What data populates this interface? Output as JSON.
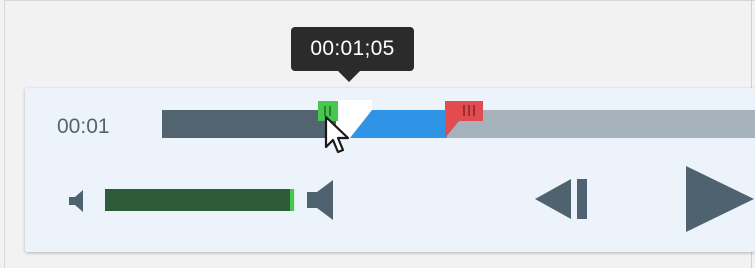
{
  "tooltip": {
    "time": "00:01;05"
  },
  "player": {
    "current_time": "00:01",
    "timeline": {
      "played_fraction": 0.305,
      "selection_end_fraction": 0.48
    },
    "volume": {
      "level": 0.99
    }
  },
  "colors": {
    "played": "#516470",
    "selection": "#2f94e6",
    "remaining": "#a7b3bc",
    "in_marker": "#45c84e",
    "out_marker": "#e04c4f",
    "volume_fill": "#2e5b3a",
    "icon": "#4f6270"
  },
  "icons": {
    "in_marker": "in-point-marker-icon",
    "out_marker": "out-point-marker-icon",
    "playhead": "playhead-icon",
    "cursor": "mouse-pointer-icon",
    "volume_low": "volume-low-icon",
    "volume_high": "volume-high-icon",
    "step_back": "step-back-icon",
    "play": "play-icon"
  }
}
